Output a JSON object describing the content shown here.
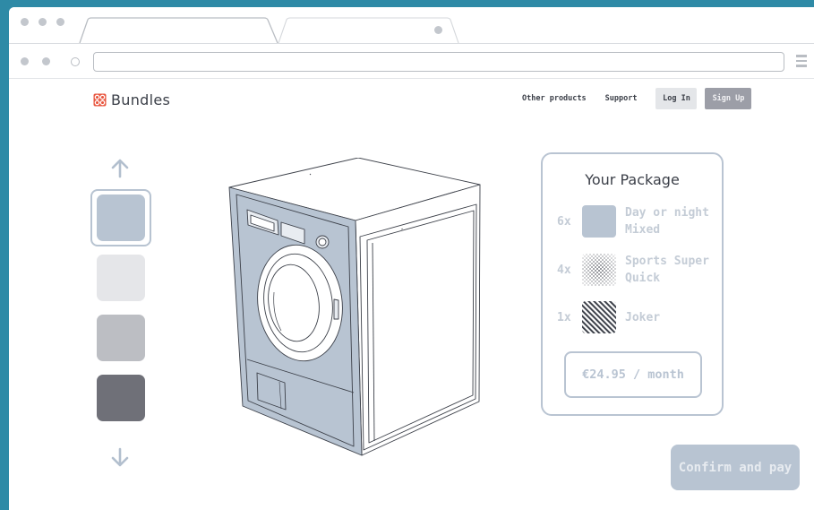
{
  "browser": {
    "url_value": "",
    "tabs": [
      {
        "title": ""
      },
      {
        "title": ""
      }
    ]
  },
  "header": {
    "brand": "Bundles",
    "nav": {
      "other_products": "Other products",
      "support": "Support",
      "login": "Log In",
      "signup": "Sign Up"
    }
  },
  "colors": {
    "accent": "#b8c4d2",
    "brand_icon": "#e8553e",
    "swatches": [
      "#b8c4d2",
      "#e5e6e9",
      "#bcbec3",
      "#6f7078"
    ]
  },
  "selector": {
    "up_icon": "arrow-up-icon",
    "down_icon": "arrow-down-icon",
    "selected_index": 0
  },
  "package": {
    "title": "Your Package",
    "items": [
      {
        "qty": "6x",
        "name": "Day or night Mixed",
        "pattern": "solid"
      },
      {
        "qty": "4x",
        "name": "Sports Super Quick",
        "pattern": "dots"
      },
      {
        "qty": "1x",
        "name": "Joker",
        "pattern": "stripes"
      }
    ],
    "price": "€24.95 / month"
  },
  "confirm": {
    "label": "Confirm and pay"
  }
}
